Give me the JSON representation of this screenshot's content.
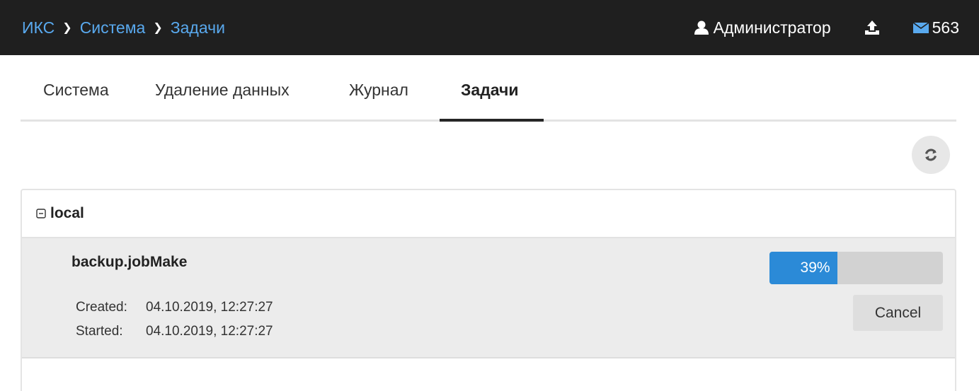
{
  "header": {
    "breadcrumb": [
      "ИКС",
      "Система",
      "Задачи"
    ],
    "user": "Администратор",
    "mail_count": "563"
  },
  "tabs": [
    {
      "label": "Система",
      "active": false
    },
    {
      "label": "Удаление данных",
      "active": false
    },
    {
      "label": "Журнал",
      "active": false
    },
    {
      "label": "Задачи",
      "active": true
    }
  ],
  "group": {
    "title": "local",
    "jobs": [
      {
        "name": "backup.jobMake",
        "progress": 0.39,
        "progress_label": "39%",
        "created_label": "Created:",
        "created": "04.10.2019, 12:27:27",
        "started_label": "Started:",
        "started": "04.10.2019, 12:27:27",
        "cancel_label": "Cancel"
      }
    ]
  },
  "colors": {
    "header_bg": "#1f1f1f",
    "breadcrumb": "#59a9ee",
    "progress_fill": "#2b8ad7",
    "progress_track": "#d2d2d2"
  },
  "icons": {
    "user": "user-icon",
    "upload": "upload-icon",
    "mail": "envelope-icon",
    "refresh": "refresh-icon",
    "collapse": "minus-square-icon",
    "breadcrumb_separator": "chevron-right-icon"
  }
}
